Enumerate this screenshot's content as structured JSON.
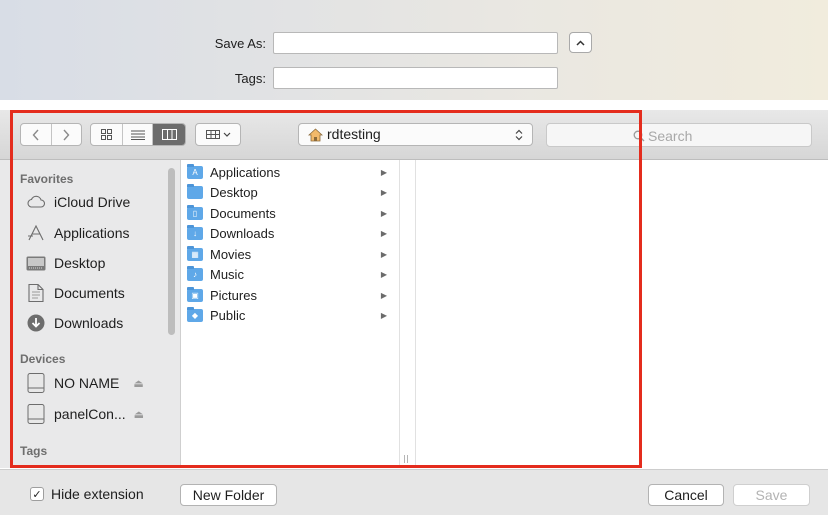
{
  "header": {
    "save_as_label": "Save As:",
    "save_as_value": "",
    "tags_label": "Tags:",
    "tags_value": ""
  },
  "toolbar": {
    "back_icon": "chevron-left",
    "forward_icon": "chevron-right",
    "view_modes": [
      "icon-view",
      "list-view",
      "column-view"
    ],
    "active_view": "column-view",
    "arrange_icon": "grid-arrange",
    "location": "rdtesting",
    "location_icon": "home",
    "search_placeholder": "Search"
  },
  "sidebar": {
    "favorites_title": "Favorites",
    "favorites": [
      {
        "label": "iCloud Drive",
        "icon": "cloud"
      },
      {
        "label": "Applications",
        "icon": "applications"
      },
      {
        "label": "Desktop",
        "icon": "desktop"
      },
      {
        "label": "Documents",
        "icon": "document"
      },
      {
        "label": "Downloads",
        "icon": "download"
      }
    ],
    "devices_title": "Devices",
    "devices": [
      {
        "label": "NO NAME",
        "icon": "drive"
      },
      {
        "label": "panelCon...",
        "icon": "drive"
      }
    ],
    "tags_title": "Tags"
  },
  "browser": {
    "items": [
      {
        "label": "Applications",
        "glyph": "A"
      },
      {
        "label": "Desktop",
        "glyph": ""
      },
      {
        "label": "Documents",
        "glyph": "▯"
      },
      {
        "label": "Downloads",
        "glyph": "↓"
      },
      {
        "label": "Movies",
        "glyph": "▦"
      },
      {
        "label": "Music",
        "glyph": "♪"
      },
      {
        "label": "Pictures",
        "glyph": "▣"
      },
      {
        "label": "Public",
        "glyph": "◆"
      }
    ],
    "arrow": "▶"
  },
  "footer": {
    "hide_extension_label": "Hide extension",
    "hide_extension_checked": true,
    "new_folder_label": "New Folder",
    "cancel_label": "Cancel",
    "save_label": "Save"
  },
  "colors": {
    "highlight": "#e42c1d",
    "folder": "#5fa8e8"
  }
}
